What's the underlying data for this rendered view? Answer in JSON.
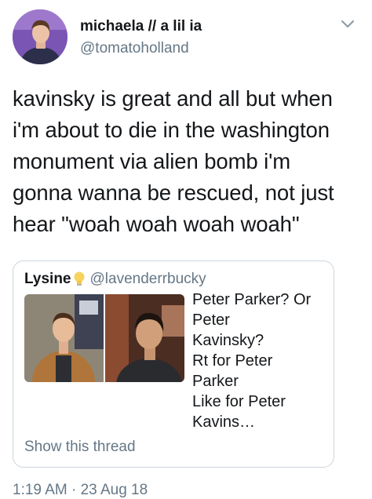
{
  "author": {
    "display_name": "michaela // a lil ia",
    "handle": "@tomatoholland"
  },
  "tweet": {
    "text": "kavinsky is great and all but when\ni'm about to die in the washington\nmonument via alien bomb i'm\ngonna wanna be rescued, not just\nhear \"woah woah woah woah\""
  },
  "quoted": {
    "display_name": "Lysine",
    "handle": "@lavenderrbucky",
    "text": "Peter Parker? Or Peter\nKavinsky?\nRt for Peter Parker\nLike for Peter Kavins…",
    "show_thread": "Show this thread"
  },
  "meta": {
    "timestamp": "1:19 AM · 23 Aug 18"
  },
  "colors": {
    "primary_text": "#14171a",
    "secondary_text": "#657786",
    "border": "#ccd6dd"
  },
  "icons": [
    "chevron-down-icon",
    "lightbulb-emoji-icon"
  ]
}
